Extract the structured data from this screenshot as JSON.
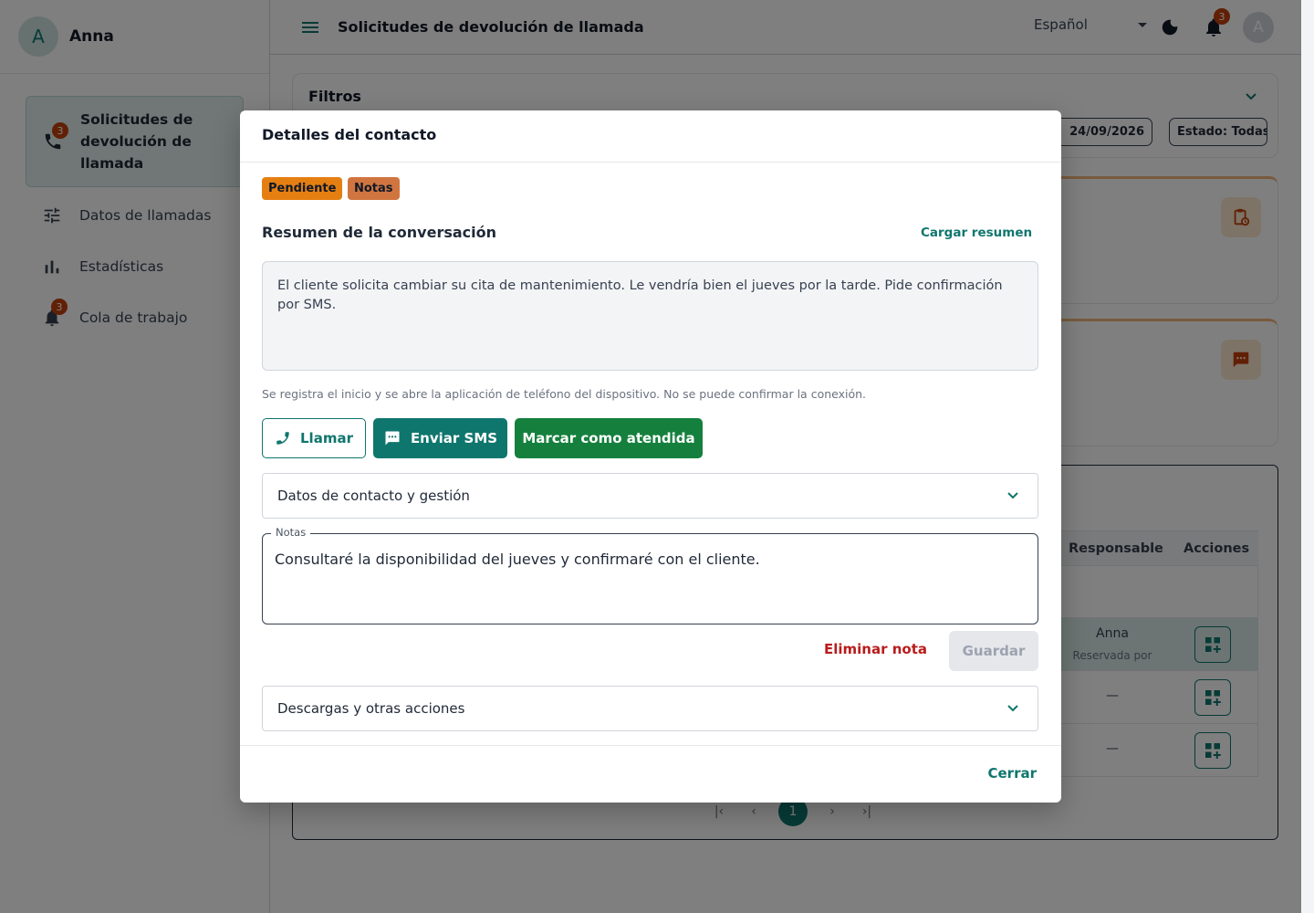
{
  "user": {
    "initial": "A",
    "name": "Anna"
  },
  "sidebar": {
    "items": [
      {
        "label": "Solicitudes de devolución de llamada",
        "badge": "3",
        "icon": "phone-icon",
        "active": true
      },
      {
        "label": "Datos de llamadas",
        "icon": "sliders-icon"
      },
      {
        "label": "Estadísticas",
        "icon": "bar-chart-icon"
      },
      {
        "label": "Cola de trabajo",
        "badge": "3",
        "icon": "bell-icon"
      }
    ]
  },
  "header": {
    "title": "Solicitudes de devolución de llamada",
    "language": "Español",
    "notifications_badge": "3",
    "avatar_initial": "A"
  },
  "filters": {
    "title": "Filtros",
    "chip_date": "24/09/2026",
    "chip_status": "Estado: Todas"
  },
  "table": {
    "columns": [
      "Responsable",
      "Acciones"
    ],
    "rows": [
      {
        "responsible": "Anna",
        "sub": "Reservada por",
        "highlighted": true
      },
      {
        "responsible": "—",
        "sub": ""
      },
      {
        "responsible": "—",
        "sub": ""
      }
    ]
  },
  "pagination": {
    "current": "1"
  },
  "dialog": {
    "title": "Detalles del contacto",
    "tags": [
      "Pendiente",
      "Notas"
    ],
    "summary_title": "Resumen de la conversación",
    "load_summary": "Cargar resumen",
    "summary_text": "El cliente solicita cambiar su cita de mantenimiento. Le vendría bien el jueves por la tarde. Pide confirmación por SMS.",
    "hint": "Se registra el inicio y se abre la aplicación de teléfono del dispositivo. No se puede confirmar la conexión.",
    "call_label": "Llamar",
    "sms_label": "Enviar SMS",
    "done_label": "Marcar como atendida",
    "contact_section": "Datos de contacto y gestión",
    "notes_label": "Notas",
    "notes_value": "Consultaré la disponibilidad del jueves y confirmaré con el cliente.",
    "delete_note": "Eliminar nota",
    "save": "Guardar",
    "downloads_section": "Descargas y otras acciones",
    "close": "Cerrar"
  },
  "colors": {
    "primary": "#0f766e",
    "success": "#15803d",
    "danger": "#b91c1c",
    "tag_pending": "#e57f12",
    "tag_notes": "#d0753f"
  }
}
